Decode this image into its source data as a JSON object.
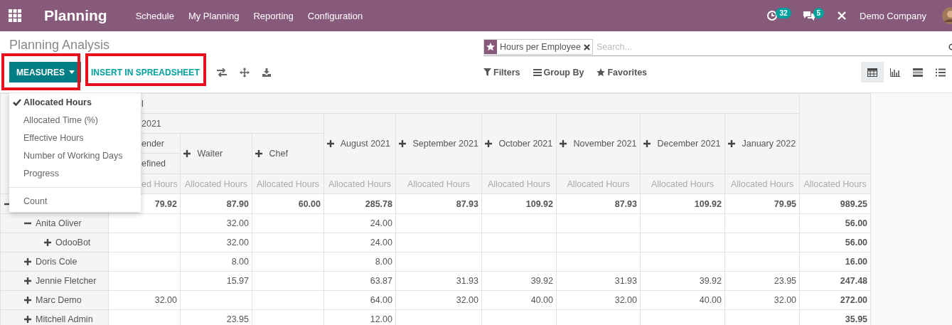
{
  "app": {
    "name": "Planning",
    "menu": [
      "Schedule",
      "My Planning",
      "Reporting",
      "Configuration"
    ]
  },
  "systray": {
    "activity_count": "32",
    "message_count": "5",
    "company": "Demo Company"
  },
  "breadcrumb": "Planning Analysis",
  "toolbar": {
    "measures": "MEASURES",
    "insert": "INSERT IN SPREADSHEET"
  },
  "highlights": {
    "measures": true,
    "insert": true
  },
  "search": {
    "facet": "Hours per Employee",
    "placeholder": "Search..."
  },
  "search_options": [
    {
      "label": "Filters",
      "kind": "filter"
    },
    {
      "label": "Group By",
      "kind": "groupby"
    },
    {
      "label": "Favorites",
      "kind": "favorite"
    }
  ],
  "views": [
    {
      "kind": "pivot",
      "selected": true
    },
    {
      "kind": "graph",
      "selected": false
    },
    {
      "kind": "gantt",
      "selected": false
    },
    {
      "kind": "list",
      "selected": false
    }
  ],
  "measures_menu": [
    {
      "label": "Allocated Hours",
      "checked": true
    },
    {
      "label": "Allocated Time (%)",
      "checked": false
    },
    {
      "label": "Effective Hours",
      "checked": false
    },
    {
      "label": "Number of Working Days",
      "checked": false
    },
    {
      "label": "Progress",
      "checked": false
    }
  ],
  "measures_extra": [
    {
      "label": "Count",
      "checked": false
    }
  ],
  "pivot": {
    "total_header": "l",
    "period_header": "2021",
    "groups": [
      {
        "label": "ender",
        "children": [
          {
            "label": "efined"
          }
        ]
      },
      {
        "label": "Waiter",
        "expanded": false
      },
      {
        "label": "Chef",
        "expanded": false
      }
    ],
    "months": [
      {
        "label": "August 2021",
        "expanded": false
      },
      {
        "label": "September 2021",
        "expanded": false
      },
      {
        "label": "October 2021",
        "expanded": false
      },
      {
        "label": "November 2021",
        "expanded": false
      },
      {
        "label": "December 2021",
        "expanded": false
      },
      {
        "label": "January 2022",
        "expanded": false
      }
    ],
    "measure_headers": [
      "ed Hours",
      "Allocated Hours",
      "Allocated Hours",
      "Allocated Hours",
      "Allocated Hours",
      "Allocated Hours",
      "Allocated Hours",
      "Allocated Hours",
      "Allocated Hours",
      "Allocated Hours"
    ],
    "rows": [
      {
        "expanded": true,
        "values": {
          "bartender": "79.92",
          "waiter": "87.90",
          "chef": "60.00",
          "aug": "285.78",
          "sep": "87.93",
          "oct": "109.92",
          "nov": "87.93",
          "dec": "109.92",
          "jan": "79.95",
          "total": "989.25"
        },
        "children": [
          {
            "label": "Anita Oliver",
            "expanded": true,
            "values": {
              "waiter": "32.00",
              "aug": "24.00",
              "total": "56.00"
            },
            "children": [
              {
                "label": "OdooBot",
                "expanded": false,
                "values": {
                  "waiter": "32.00",
                  "aug": "24.00",
                  "total": "56.00"
                }
              }
            ]
          },
          {
            "label": "Doris Cole",
            "expanded": false,
            "values": {
              "waiter": "8.00",
              "aug": "8.00",
              "total": "16.00"
            }
          },
          {
            "label": "Jennie Fletcher",
            "expanded": false,
            "values": {
              "waiter": "15.97",
              "aug": "63.87",
              "sep": "31.93",
              "oct": "39.92",
              "nov": "31.93",
              "dec": "39.92",
              "jan": "23.95",
              "total": "247.48"
            }
          },
          {
            "label": "Marc Demo",
            "expanded": false,
            "values": {
              "bartender": "32.00",
              "aug": "64.00",
              "sep": "32.00",
              "oct": "40.00",
              "nov": "32.00",
              "dec": "40.00",
              "jan": "32.00",
              "total": "272.00"
            }
          },
          {
            "label": "Mitchell Admin",
            "expanded": false,
            "values": {
              "waiter": "23.95",
              "aug": "12.00",
              "total": "35.95"
            }
          }
        ]
      }
    ]
  }
}
